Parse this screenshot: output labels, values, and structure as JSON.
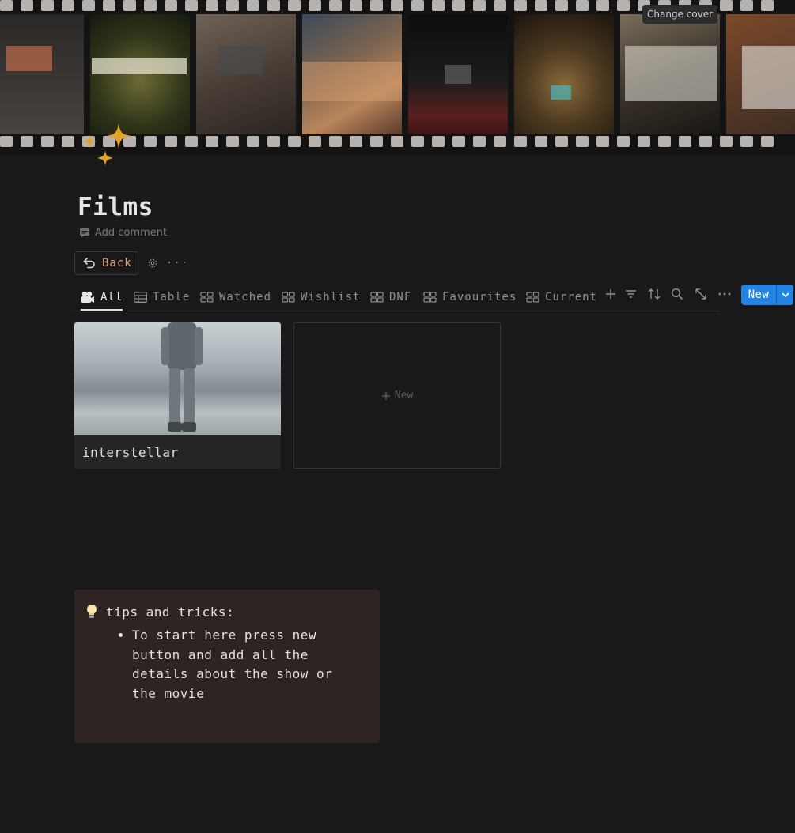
{
  "cover": {
    "change_cover_label": "Change cover"
  },
  "page": {
    "title": "Films",
    "add_comment": "Add comment",
    "back_label": "Back",
    "page_icon": "sparkles-icon"
  },
  "tabs": [
    {
      "label": "All",
      "icon": "film-camera-icon",
      "active": true
    },
    {
      "label": "Table",
      "icon": "table-icon"
    },
    {
      "label": "Watched",
      "icon": "gallery-icon"
    },
    {
      "label": "Wishlist",
      "icon": "gallery-icon"
    },
    {
      "label": "DNF",
      "icon": "gallery-icon"
    },
    {
      "label": "Favourites",
      "icon": "gallery-icon"
    },
    {
      "label": "Current",
      "icon": "gallery-icon"
    }
  ],
  "toolbar": {
    "new_label": "New"
  },
  "gallery": {
    "cards": [
      {
        "title": "interstellar"
      }
    ],
    "add_label": "New"
  },
  "callout": {
    "icon": "light-bulb-icon",
    "heading": "tips and tricks:",
    "bullets": [
      "To start here press new button and add all the details about the show or the movie"
    ]
  },
  "colors": {
    "background": "#191919",
    "accent": "#2383e2",
    "back_text": "#e7a07a",
    "sparkle": "#e1a32e",
    "callout_bg": "#2e2522"
  }
}
